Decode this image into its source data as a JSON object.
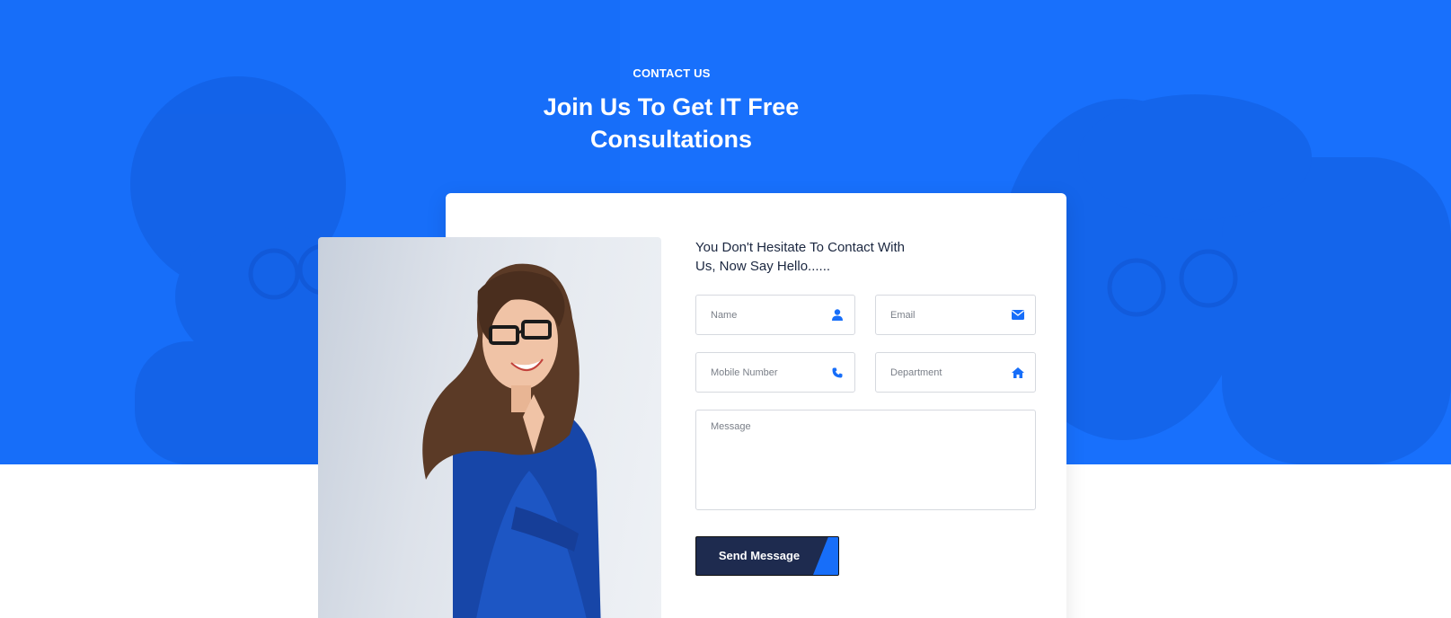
{
  "hero": {
    "tag": "CONTACT US",
    "title": "Join Us To Get IT Free Consultations",
    "background_color": "#176ef9"
  },
  "form": {
    "heading": "You Don't Hesitate To Contact With Us, Now Say Hello......",
    "fields": {
      "name": {
        "placeholder": "Name",
        "value": "",
        "icon": "user-icon"
      },
      "email": {
        "placeholder": "Email",
        "value": "",
        "icon": "envelope-icon"
      },
      "mobile": {
        "placeholder": "Mobile Number",
        "value": "",
        "icon": "phone-icon"
      },
      "department": {
        "placeholder": "Department",
        "value": "",
        "icon": "home-icon"
      },
      "message": {
        "placeholder": "Message",
        "value": ""
      }
    },
    "submit_label": "Send Message",
    "icon_color": "#176ef9",
    "button_color": "#1e2b4f"
  }
}
